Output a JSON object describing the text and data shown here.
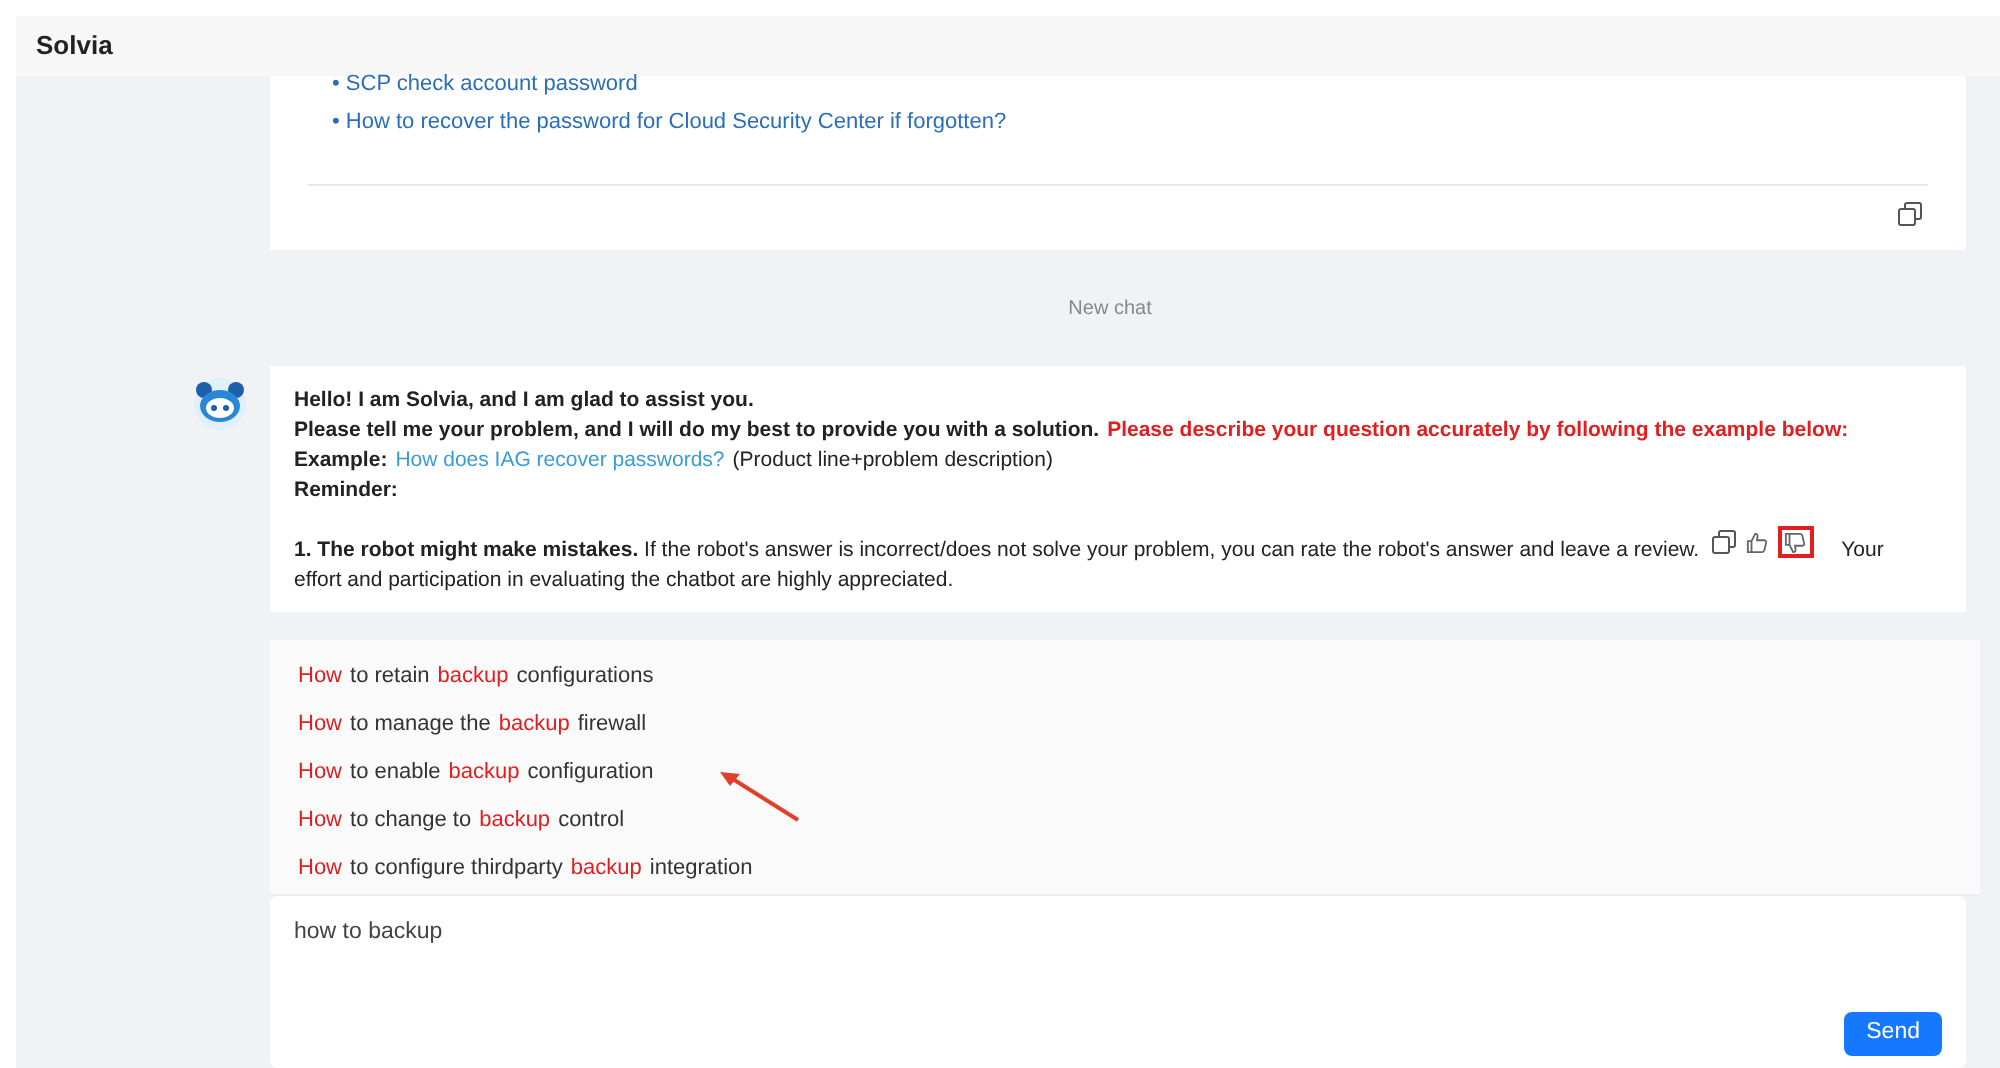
{
  "header": {
    "title": "Solvia"
  },
  "previous_answer": {
    "links": [
      "• SCP check account password",
      "• How to recover the password for Cloud Security Center if forgotten?"
    ]
  },
  "divider_label": "New chat",
  "message": {
    "greeting": "Hello! I am Solvia, and I am glad to assist you.",
    "request": "Please tell me your problem, and I will do my best to provide you with a solution.",
    "request_emphasis": "Please describe your question accurately by following the example below:",
    "example_label": "Example:",
    "example_link": "How does IAG recover passwords?",
    "example_note": "(Product line+problem description)",
    "reminder_label": "Reminder:",
    "reminder_start": "**1. The robot might make mistakes.** If the robot's answer is incorrect/does not solve your problem, you can rate the robot's answer and leave a review.",
    "reminder_end": "Your",
    "reminder_cont": "effort and participation in evaluating the chatbot are highly appreciated.",
    "dislike_marked": true
  },
  "suggestions": [
    {
      "parts": [
        {
          "text": "How",
          "match": true
        },
        {
          "text": "to retain",
          "match": false
        },
        {
          "text": "backup",
          "match": true
        },
        {
          "text": "configurations",
          "match": false
        }
      ]
    },
    {
      "parts": [
        {
          "text": "How",
          "match": true
        },
        {
          "text": "to manage the",
          "match": false
        },
        {
          "text": "backup",
          "match": true
        },
        {
          "text": "firewall",
          "match": false
        }
      ]
    },
    {
      "parts": [
        {
          "text": "How",
          "match": true
        },
        {
          "text": "to enable",
          "match": false
        },
        {
          "text": "backup",
          "match": true
        },
        {
          "text": "configuration",
          "match": false
        }
      ]
    },
    {
      "parts": [
        {
          "text": "How",
          "match": true
        },
        {
          "text": "to change to",
          "match": false
        },
        {
          "text": "backup",
          "match": true
        },
        {
          "text": "control",
          "match": false
        }
      ]
    },
    {
      "parts": [
        {
          "text": "How",
          "match": true
        },
        {
          "text": "to configure thirdparty",
          "match": false
        },
        {
          "text": "backup",
          "match": true
        },
        {
          "text": "integration",
          "match": false
        }
      ]
    }
  ],
  "input": {
    "value": "how to backup",
    "send": "Send"
  }
}
